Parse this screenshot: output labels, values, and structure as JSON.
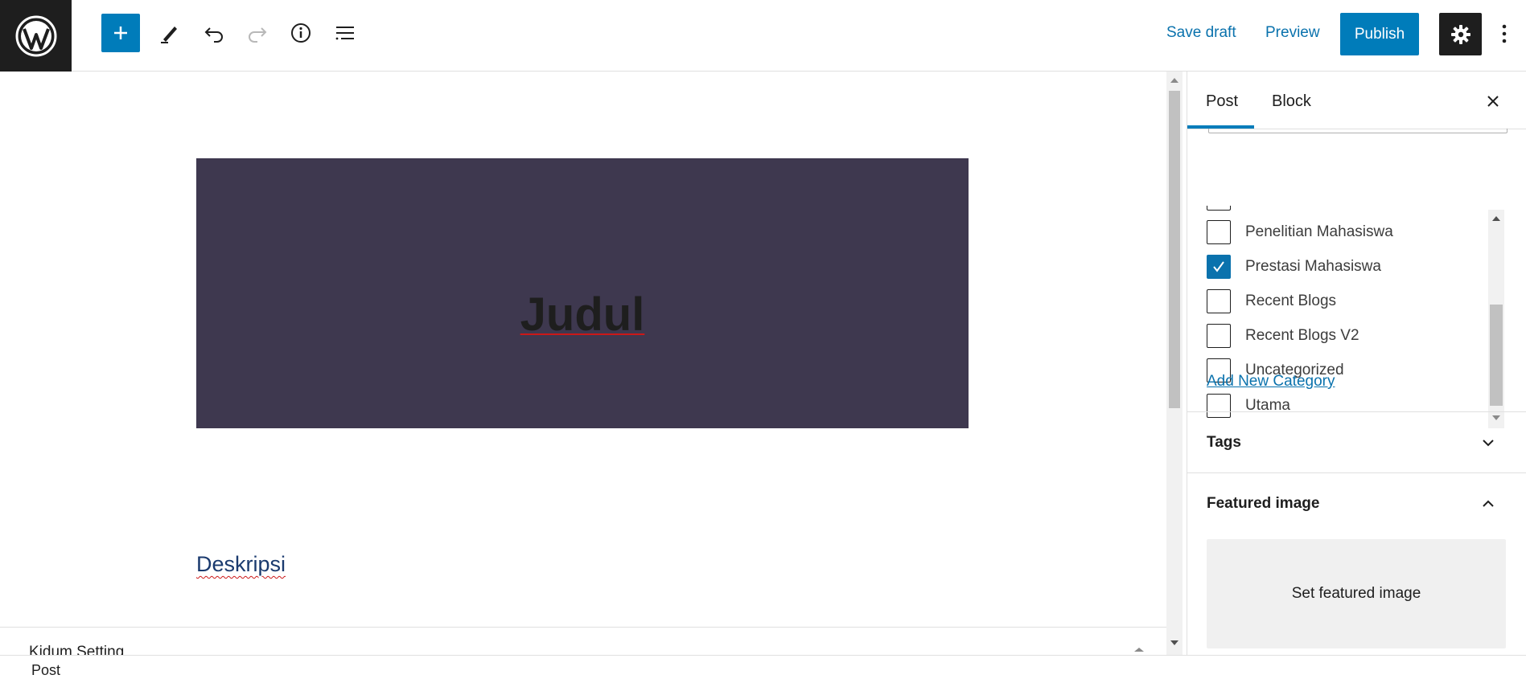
{
  "toolbar": {
    "save_draft_label": "Save draft",
    "preview_label": "Preview",
    "publish_label": "Publish",
    "accent_color": "#007cba",
    "icons": [
      "wordpress-logo-icon",
      "plus-icon",
      "pencil-icon",
      "undo-icon",
      "redo-icon",
      "info-icon",
      "list-view-icon",
      "gear-icon",
      "more-vertical-icon"
    ]
  },
  "editor": {
    "cover_title": "Judul",
    "cover_background": "#3e384f",
    "description": "Deskripsi",
    "meta_panel_title": "Kidum Setting"
  },
  "sidebar": {
    "tabs": [
      {
        "label": "Post",
        "active": true
      },
      {
        "label": "Block",
        "active": false
      }
    ],
    "categories": [
      {
        "label": "Penelitian Mahasiswa",
        "checked": false
      },
      {
        "label": "Prestasi Mahasiswa",
        "checked": true
      },
      {
        "label": "Recent Blogs",
        "checked": false
      },
      {
        "label": "Recent Blogs V2",
        "checked": false
      },
      {
        "label": "Uncategorized",
        "checked": false
      },
      {
        "label": "Utama",
        "checked": false
      }
    ],
    "add_category_label": "Add New Category",
    "panels": {
      "tags_title": "Tags",
      "featured_title": "Featured image",
      "set_featured_label": "Set featured image"
    }
  },
  "footer": {
    "breadcrumb": "Post"
  }
}
